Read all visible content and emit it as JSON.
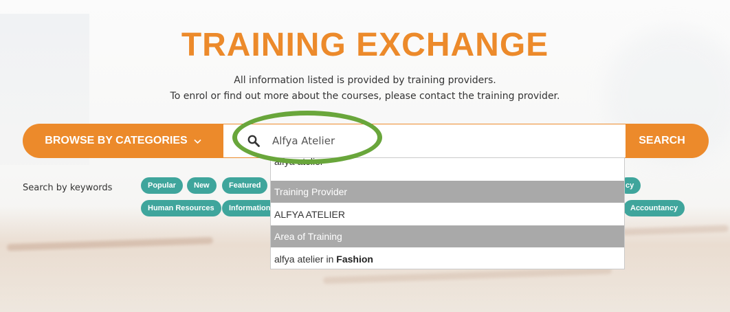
{
  "header": {
    "title": "TRAINING EXCHANGE",
    "subtitle_line1": "All information listed is provided by training providers.",
    "subtitle_line2": "To enrol or find out more about the courses, please contact the training provider."
  },
  "search_bar": {
    "browse_label": "BROWSE BY CATEGORIES",
    "browse_icon": "chevron-down-icon",
    "search_icon": "magnifier-icon",
    "input_value": "Alfya Atelier",
    "search_button": "SEARCH"
  },
  "keywords": {
    "label": "Search by keywords",
    "row1": [
      "Popular",
      "New",
      "Featured"
    ],
    "row1_partial_right": "cy",
    "row2": [
      "Human Resources",
      "Information"
    ],
    "row2_right": "Accountancy"
  },
  "autocomplete": {
    "cut_off_item": "alfya atelier",
    "groups": [
      {
        "header": "Training Provider",
        "items": [
          "ALFYA ATELIER"
        ]
      },
      {
        "header": "Area of Training",
        "item_prefix": "alfya atelier in ",
        "item_bold": "Fashion"
      }
    ]
  },
  "colors": {
    "brand_orange": "#ec8a2b",
    "tag_teal": "#3fa59c",
    "highlight_green": "#69a63b",
    "group_header_gray": "#a9a9a9"
  }
}
